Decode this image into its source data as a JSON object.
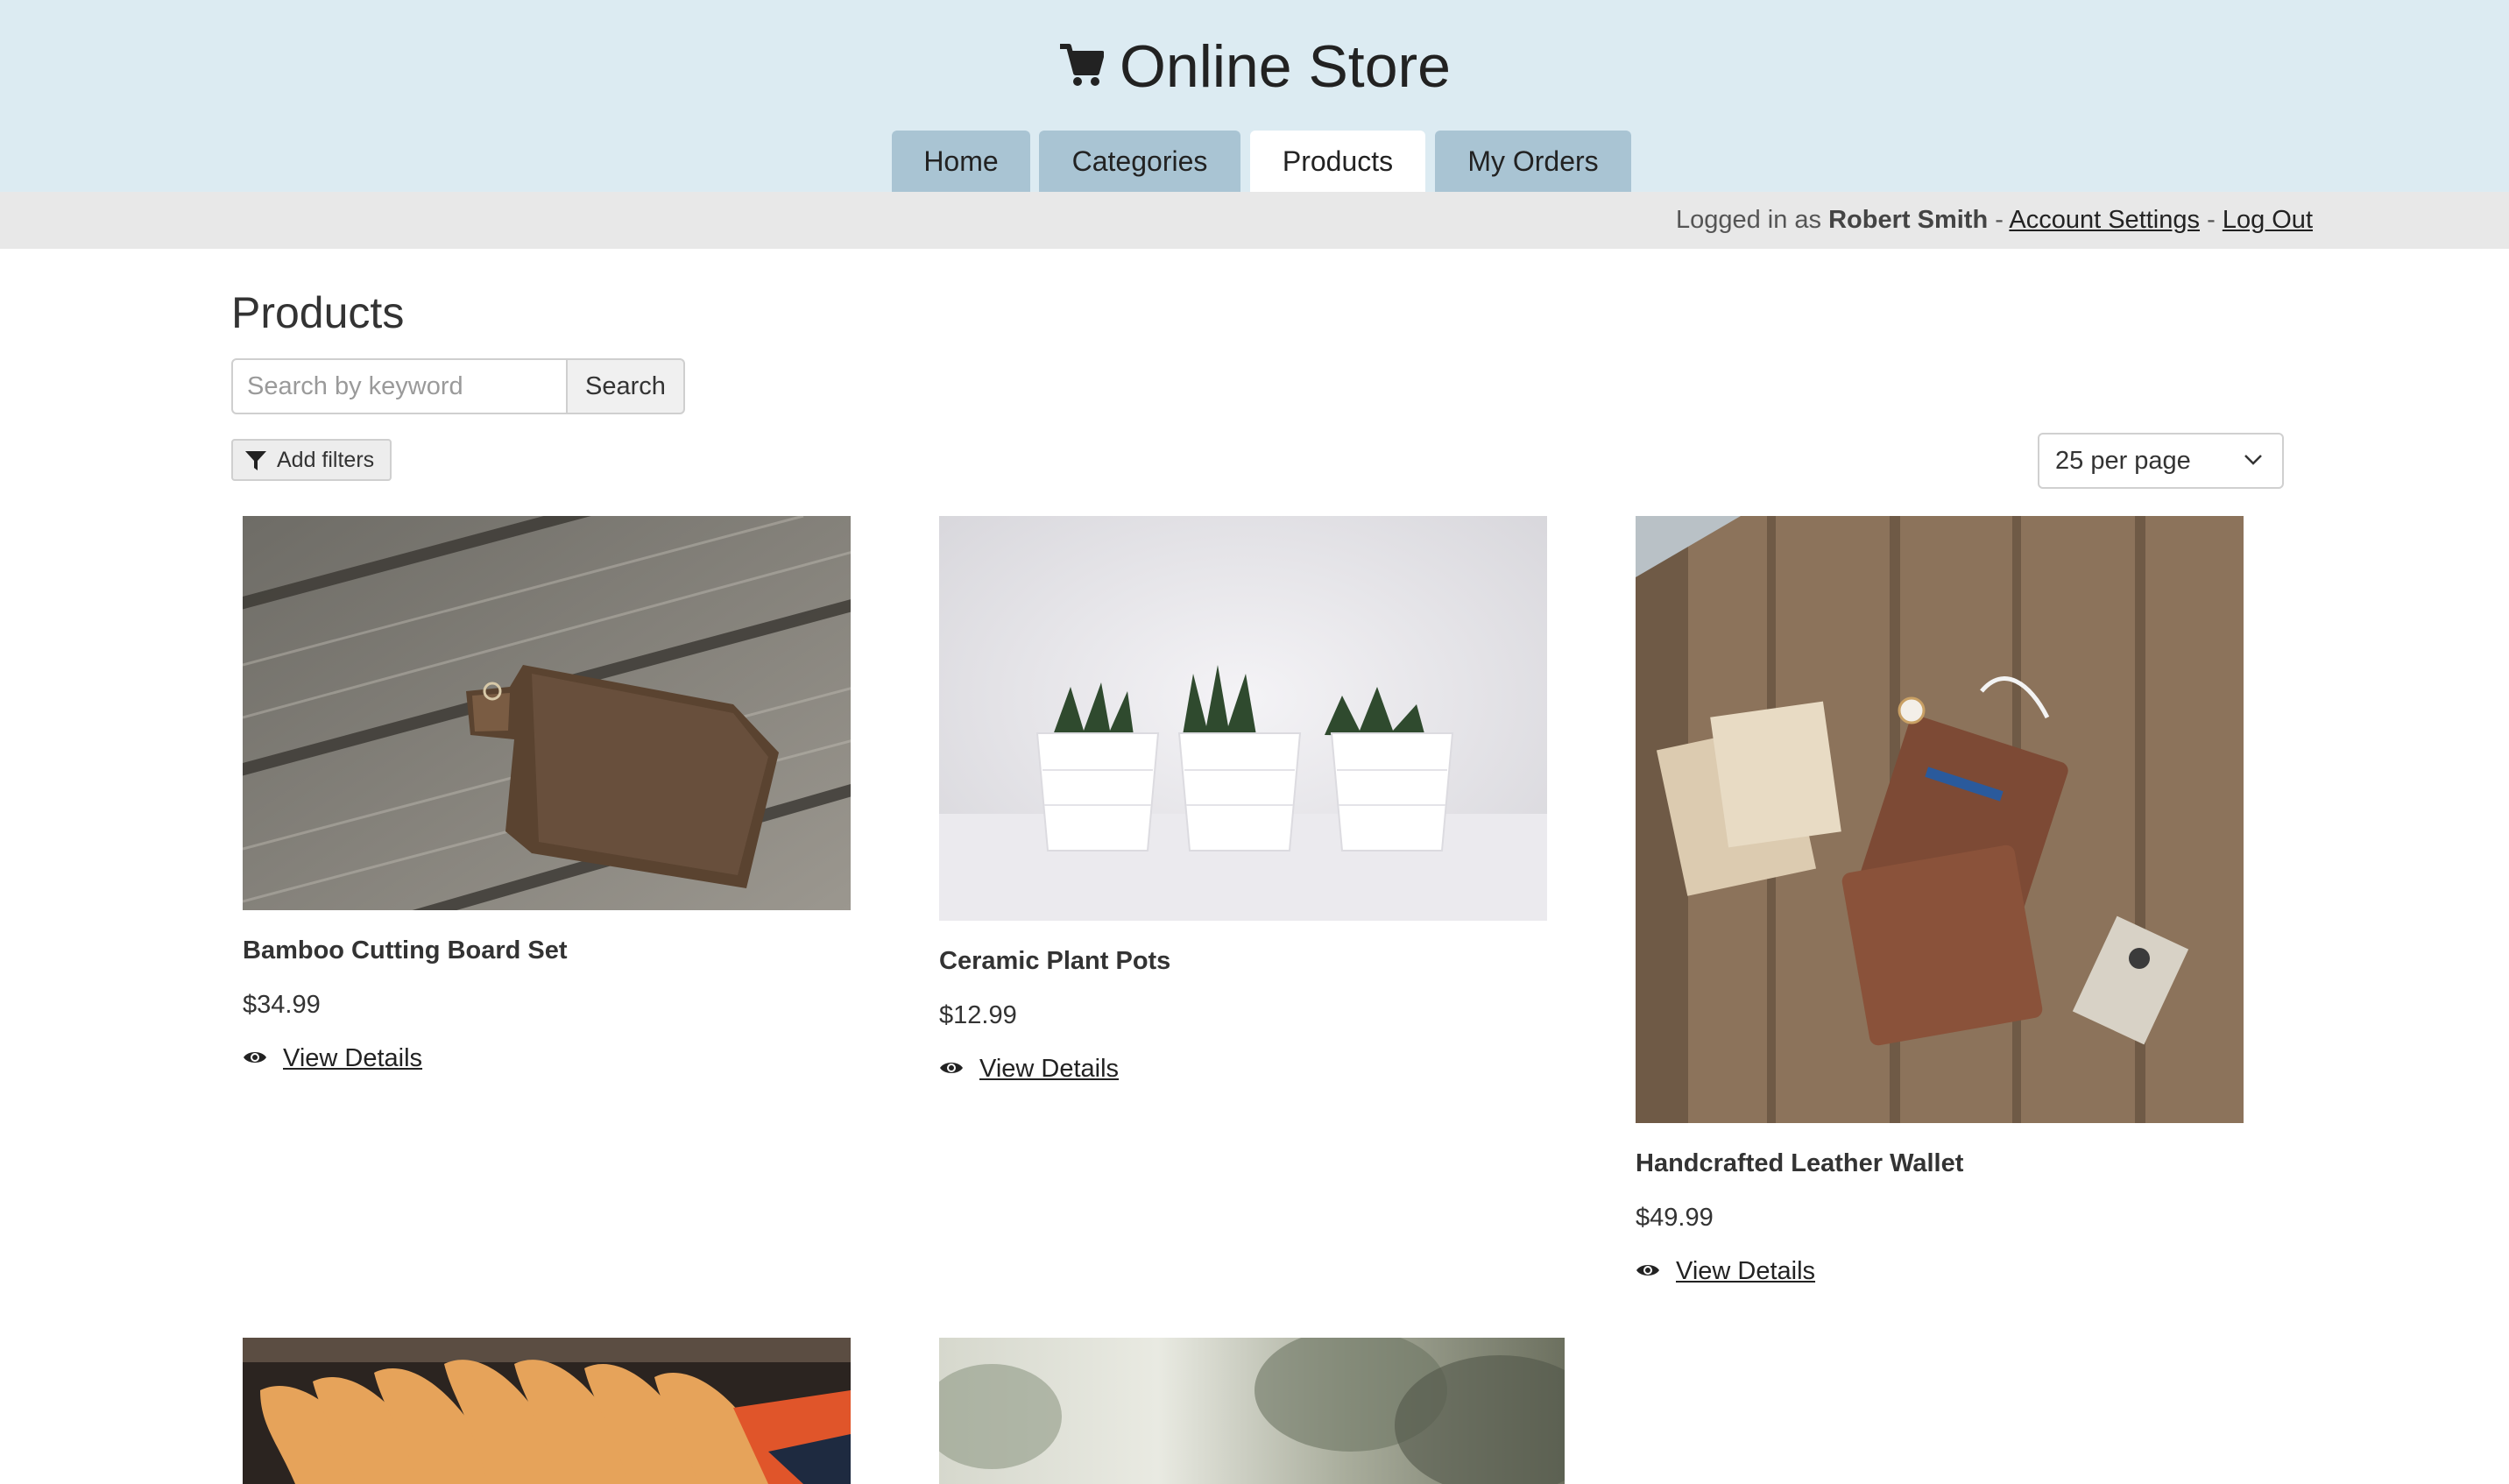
{
  "header": {
    "title": "Online Store",
    "cart_icon": "shopping-cart-icon",
    "tabs": [
      {
        "label": "Home",
        "active": false
      },
      {
        "label": "Categories",
        "active": false
      },
      {
        "label": "Products",
        "active": true
      },
      {
        "label": "My Orders",
        "active": false
      }
    ],
    "background_color": "#dcebf2",
    "tab_color": "#a9c4d3"
  },
  "userbar": {
    "prefix": "Logged in as",
    "user_name": "Robert Smith",
    "separator": "-",
    "account_settings": "Account Settings",
    "log_out": "Log Out"
  },
  "main": {
    "title": "Products",
    "search": {
      "placeholder": "Search by keyword",
      "value": "",
      "button_label": "Search"
    },
    "filters_label": "Add filters",
    "per_page": "25 per page",
    "products": [
      {
        "name": "Bamboo Cutting Board Set",
        "price": "$34.99",
        "link": "View Details"
      },
      {
        "name": "Ceramic Plant Pots",
        "price": "$12.99",
        "link": "View Details"
      },
      {
        "name": "Handcrafted Leather Wallet",
        "price": "$49.99",
        "link": "View Details"
      }
    ]
  }
}
